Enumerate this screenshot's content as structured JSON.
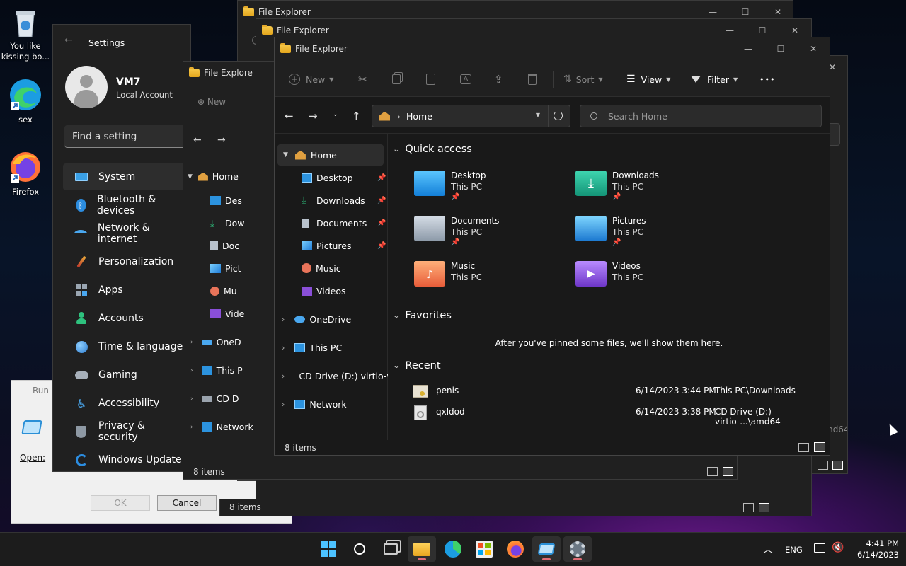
{
  "desktop": {
    "icons": [
      {
        "label": "You like kissing bo...",
        "icon": "recycle-bin-icon"
      },
      {
        "label": "sex",
        "icon": "edge-shortcut-icon"
      },
      {
        "label": "Firefox",
        "icon": "firefox-icon"
      }
    ]
  },
  "settings": {
    "title": "Settings",
    "user_name": "VM7",
    "user_type": "Local Account",
    "search_placeholder": "Find a setting",
    "nav": [
      {
        "label": "System",
        "icon": "monitor-icon"
      },
      {
        "label": "Bluetooth & devices",
        "icon": "bluetooth-icon"
      },
      {
        "label": "Network & internet",
        "icon": "wifi-icon"
      },
      {
        "label": "Personalization",
        "icon": "brush-icon"
      },
      {
        "label": "Apps",
        "icon": "apps-icon"
      },
      {
        "label": "Accounts",
        "icon": "person-icon"
      },
      {
        "label": "Time & language",
        "icon": "globe-clock-icon"
      },
      {
        "label": "Gaming",
        "icon": "gamepad-icon"
      },
      {
        "label": "Accessibility",
        "icon": "accessibility-icon"
      },
      {
        "label": "Privacy & security",
        "icon": "shield-icon"
      },
      {
        "label": "Windows Update",
        "icon": "update-icon"
      }
    ]
  },
  "run": {
    "title": "Run",
    "open_label": "Open:",
    "ok_label": "OK",
    "cancel_label": "Cancel"
  },
  "bg_explorers": {
    "title_1": "File Explorer",
    "title_2": "File Explorer",
    "title_3": "File Explore",
    "new_label": "New",
    "home_label": "Home",
    "tree": [
      "Des",
      "Dow",
      "Doc",
      "Pict",
      "Mu",
      "Vide",
      "OneD",
      "This P",
      "CD D",
      "Network"
    ],
    "items_label": "8 items",
    "items_short": "8 i",
    "path_fragment": "md64"
  },
  "explorer": {
    "title": "File Explorer",
    "toolbar": {
      "new": "New",
      "sort": "Sort",
      "view": "View",
      "filter": "Filter",
      "more": "•••"
    },
    "address": "Home",
    "search_placeholder": "Search Home",
    "nav": {
      "home": "Home",
      "quick": [
        "Desktop",
        "Downloads",
        "Documents",
        "Pictures",
        "Music",
        "Videos"
      ],
      "roots": [
        "OneDrive",
        "This PC",
        "CD Drive (D:) virtio-w",
        "Network"
      ]
    },
    "sections": {
      "quick_access": "Quick access",
      "favorites": "Favorites",
      "recent": "Recent"
    },
    "quick_access": [
      {
        "name": "Desktop",
        "location": "This PC",
        "pinned": true
      },
      {
        "name": "Downloads",
        "location": "This PC",
        "pinned": true
      },
      {
        "name": "Documents",
        "location": "This PC",
        "pinned": true
      },
      {
        "name": "Pictures",
        "location": "This PC",
        "pinned": true
      },
      {
        "name": "Music",
        "location": "This PC",
        "pinned": false
      },
      {
        "name": "Videos",
        "location": "This PC",
        "pinned": false
      }
    ],
    "favorites_empty": "After you've pinned some files, we'll show them here.",
    "recent": [
      {
        "name": "penis",
        "date": "6/14/2023 3:44 PM",
        "location": "This PC\\Downloads"
      },
      {
        "name": "qxldod",
        "date": "6/14/2023 3:38 PM",
        "location": "CD Drive (D:) virtio-...\\amd64"
      }
    ],
    "status": "8 items"
  },
  "taskbar": {
    "lang": "ENG",
    "time": "4:41 PM",
    "date": "6/14/2023",
    "apps": [
      "start-icon",
      "search-icon",
      "task-view-icon",
      "file-explorer-icon",
      "edge-icon",
      "store-icon",
      "firefox-icon",
      "run-icon",
      "settings-icon"
    ]
  },
  "colors": {
    "accent": "#60cdff",
    "window": "#202020",
    "folder": "#f2b632",
    "taskbar": "#1c1c1c"
  }
}
